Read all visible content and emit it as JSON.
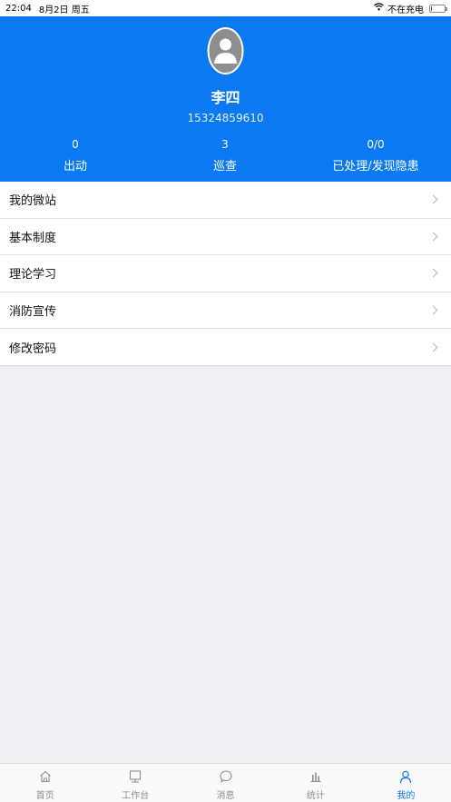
{
  "status_bar": {
    "time": "22:04",
    "date": "8月2日 周五",
    "charging": "不在充电",
    "battery_level": 0.08
  },
  "profile": {
    "name": "李四",
    "phone": "15324859610",
    "stats": [
      {
        "value": "0",
        "label": "出动"
      },
      {
        "value": "3",
        "label": "巡查"
      },
      {
        "value": "0/0",
        "label": "已处理/发现隐患"
      }
    ]
  },
  "menu": [
    {
      "label": "我的微站"
    },
    {
      "label": "基本制度"
    },
    {
      "label": "理论学习"
    },
    {
      "label": "消防宣传"
    },
    {
      "label": "修改密码"
    }
  ],
  "tabbar": [
    {
      "label": "首页",
      "icon": "home-icon"
    },
    {
      "label": "工作台",
      "icon": "desktop-icon"
    },
    {
      "label": "消息",
      "icon": "chat-bubble-icon"
    },
    {
      "label": "统计",
      "icon": "bar-chart-icon"
    },
    {
      "label": "我的",
      "icon": "person-icon"
    }
  ],
  "colors": {
    "primary": "#0a79f2",
    "background": "#efeff4",
    "inactive_tab": "#8c8c8c"
  }
}
